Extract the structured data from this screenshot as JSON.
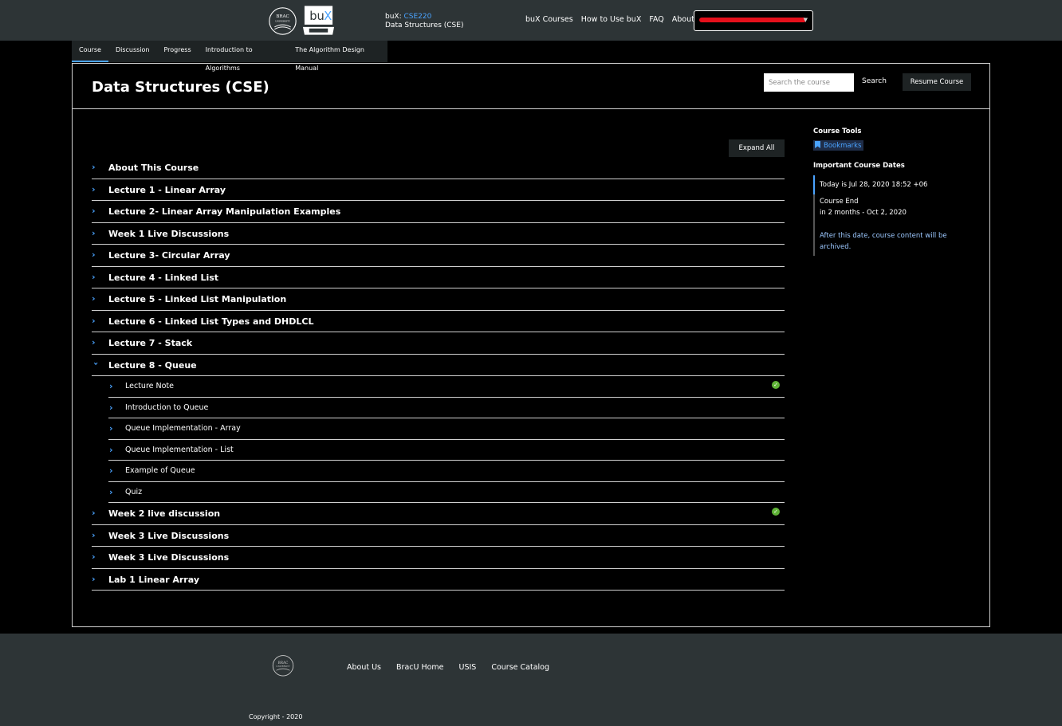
{
  "header": {
    "brand_prefix": "buX:",
    "course_code": "CSE220",
    "course_name": "Data Structures (CSE)",
    "nav": [
      "buX Courses",
      "How to Use buX",
      "FAQ",
      "About Us"
    ],
    "logo_text": "buX",
    "brac_logo_text": "BRAC UNIVERSITY"
  },
  "tabs": [
    {
      "label": "Course",
      "active": true
    },
    {
      "label": "Discussion"
    },
    {
      "label": "Progress"
    },
    {
      "label": "Introduction to Algorithms"
    },
    {
      "label": "The Algorithm Design Manual"
    }
  ],
  "page": {
    "title": "Data Structures (CSE)",
    "search_placeholder": "Search the course",
    "search_label": "Search",
    "resume_label": "Resume Course",
    "expand_label": "Expand All"
  },
  "outline": [
    {
      "label": "About This Course"
    },
    {
      "label": "Lecture 1 - Linear Array"
    },
    {
      "label": "Lecture 2- Linear Array Manipulation Examples"
    },
    {
      "label": "Week 1 Live Discussions"
    },
    {
      "label": "Lecture 3- Circular Array"
    },
    {
      "label": "Lecture 4 - Linked List"
    },
    {
      "label": "Lecture 5 - Linked List Manipulation"
    },
    {
      "label": "Lecture 6 - Linked List Types and DHDLCL"
    },
    {
      "label": "Lecture 7 - Stack"
    },
    {
      "label": "Lecture 8 - Queue",
      "expanded": true,
      "children": [
        {
          "label": "Lecture Note",
          "complete": true
        },
        {
          "label": "Introduction to Queue"
        },
        {
          "label": "Queue Implementation - Array"
        },
        {
          "label": "Queue Implementation - List"
        },
        {
          "label": "Example of Queue"
        },
        {
          "label": "Quiz"
        }
      ]
    },
    {
      "label": "Week 2 live discussion",
      "complete": true
    },
    {
      "label": "Week 3 Live Discussions"
    },
    {
      "label": "Week 3 Live Discussions"
    },
    {
      "label": "Lab 1 Linear Array"
    }
  ],
  "sidebar": {
    "tools_heading": "Course Tools",
    "bookmarks_label": "Bookmarks",
    "dates_heading": "Important Course Dates",
    "today": "Today is Jul 28, 2020 18:52 +06",
    "course_end_label": "Course End",
    "course_end_value": "in 2 months - Oct 2, 2020",
    "archive_note": "After this date, course content will be archived."
  },
  "footer": {
    "nav": [
      "About Us",
      "BracU Home",
      "USIS",
      "Course Catalog"
    ],
    "copyright": "Copyright - 2020"
  },
  "colors": {
    "header_bg": "#2d3436",
    "accent": "#4aa3ff",
    "check": "#5fb336",
    "redaction": "#e5101b"
  }
}
